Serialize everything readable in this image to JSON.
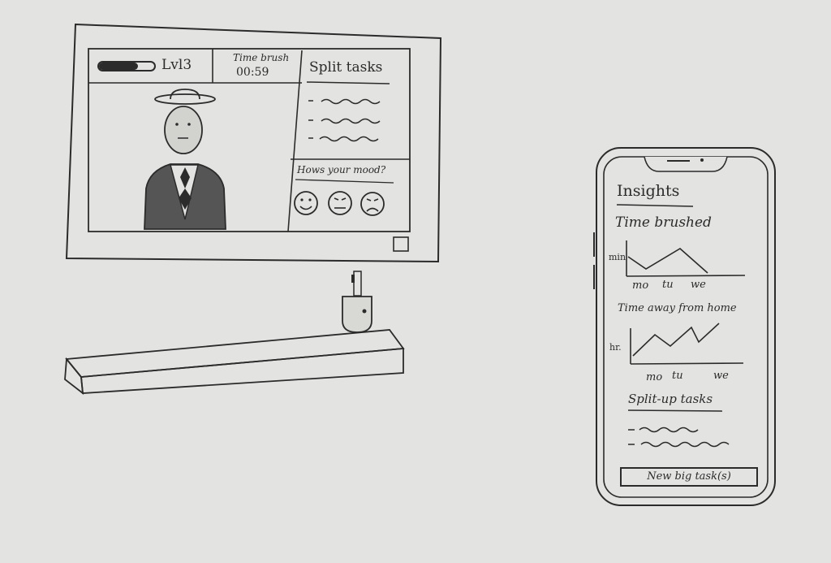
{
  "monitor": {
    "level_label": "Lvl3",
    "time_label": "Time brush",
    "time_value": "00:59",
    "tasks_title": "Split tasks",
    "mood_question": "Hows your mood?"
  },
  "phone": {
    "insights_title": "Insights",
    "time_brushed_label": "Time brushed",
    "chart1_ylabel": "min",
    "chart1_days": [
      "mo",
      "tu",
      "we"
    ],
    "time_away_label": "Time away from home",
    "chart2_ylabel": "hr.",
    "chart2_days": [
      "mo",
      "tu",
      "we"
    ],
    "split_tasks_title": "Split-up tasks",
    "new_task_button": "New big task(s)"
  },
  "colors": {
    "paper": "#e3e3e1",
    "pencil": "#2b2b2b"
  }
}
